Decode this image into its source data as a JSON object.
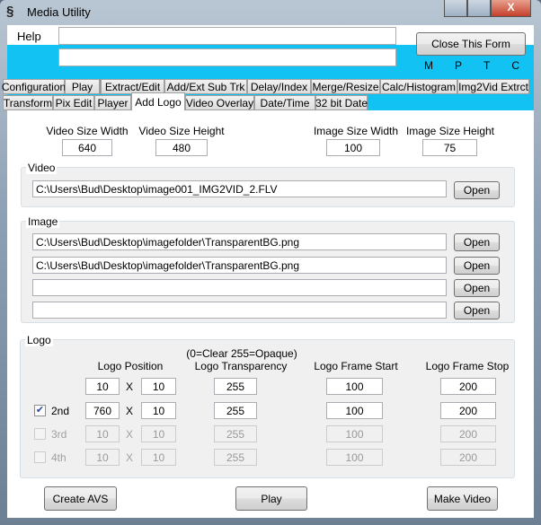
{
  "window": {
    "title": "Media Utility",
    "minimize": "–",
    "maximize": "□",
    "close": "X"
  },
  "header": {
    "help_label": "Help",
    "help_value": "",
    "help2_value": "",
    "close_form": "Close This Form",
    "indicators": [
      "M",
      "P",
      "T",
      "C"
    ]
  },
  "tabs_row1": [
    "Configuration",
    "Play",
    "Extract/Edit",
    "Add/Ext Sub Trk",
    "Delay/Index",
    "Merge/Resize",
    "Calc/Histogram",
    "Img2Vid Extrct"
  ],
  "tabs_row2": [
    "Transform",
    "Pix Edit",
    "Player",
    "Add Logo",
    "Video Overlay",
    "Date/Time",
    "32 bit Date"
  ],
  "active_tab": "Add Logo",
  "sizes": {
    "video_width_label": "Video Size Width",
    "video_width": "640",
    "video_height_label": "Video Size Height",
    "video_height": "480",
    "image_width_label": "Image Size Width",
    "image_width": "100",
    "image_height_label": "Image Size Height",
    "image_height": "75"
  },
  "video": {
    "label": "Video",
    "path": "C:\\Users\\Bud\\Desktop\\image001_IMG2VID_2.FLV",
    "open": "Open"
  },
  "image": {
    "label": "Image",
    "paths": [
      "C:\\Users\\Bud\\Desktop\\imagefolder\\TransparentBG.png",
      "C:\\Users\\Bud\\Desktop\\imagefolder\\TransparentBG.png",
      "",
      ""
    ],
    "open": "Open"
  },
  "logo": {
    "label": "Logo",
    "note": "(0=Clear  255=Opaque)",
    "col_position": "Logo Position",
    "col_transparency": "Logo Transparency",
    "col_start": "Logo Frame Start",
    "col_stop": "Logo Frame Stop",
    "x_sep": "X",
    "rows": [
      {
        "label": "",
        "checked": null,
        "enabled": true,
        "x": "10",
        "y": "10",
        "transparency": "255",
        "start": "100",
        "stop": "200"
      },
      {
        "label": "2nd",
        "checked": true,
        "enabled": true,
        "x": "760",
        "y": "10",
        "transparency": "255",
        "start": "100",
        "stop": "200"
      },
      {
        "label": "3rd",
        "checked": false,
        "enabled": false,
        "x": "10",
        "y": "10",
        "transparency": "255",
        "start": "100",
        "stop": "200"
      },
      {
        "label": "4th",
        "checked": false,
        "enabled": false,
        "x": "10",
        "y": "10",
        "transparency": "255",
        "start": "100",
        "stop": "200"
      }
    ]
  },
  "actions": {
    "create_avs": "Create AVS",
    "play": "Play",
    "make_video": "Make Video"
  }
}
